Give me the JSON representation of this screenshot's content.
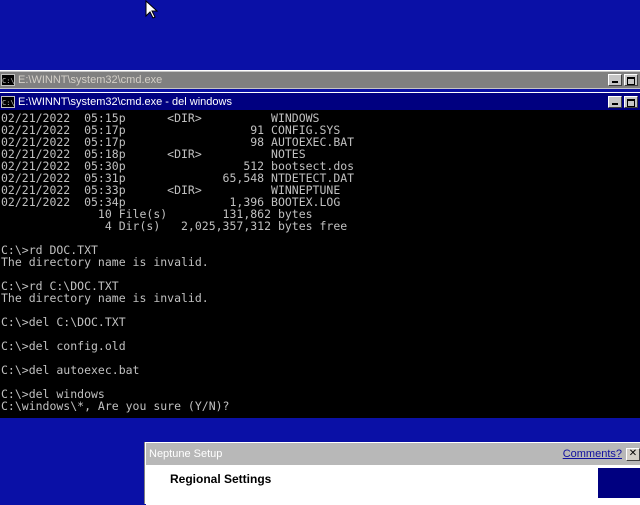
{
  "cursor": {
    "icon": "arrow-cursor-icon"
  },
  "back_window": {
    "title": "E:\\WINNT\\system32\\cmd.exe"
  },
  "front_window": {
    "title": "E:\\WINNT\\system32\\cmd.exe - del windows",
    "console_lines": [
      "02/21/2022  05:15p      <DIR>          WINDOWS",
      "02/21/2022  05:17p                  91 CONFIG.SYS",
      "02/21/2022  05:17p                  98 AUTOEXEC.BAT",
      "02/21/2022  05:18p      <DIR>          NOTES",
      "02/21/2022  05:30p                 512 bootsect.dos",
      "02/21/2022  05:31p              65,548 NTDETECT.DAT",
      "02/21/2022  05:33p      <DIR>          WINNEPTUNE",
      "02/21/2022  05:34p               1,396 BOOTEX.LOG",
      "              10 File(s)        131,862 bytes",
      "               4 Dir(s)   2,025,357,312 bytes free",
      "",
      "C:\\>rd DOC.TXT",
      "The directory name is invalid.",
      "",
      "C:\\>rd C:\\DOC.TXT",
      "The directory name is invalid.",
      "",
      "C:\\>del C:\\DOC.TXT",
      "",
      "C:\\>del config.old",
      "",
      "C:\\>del autoexec.bat",
      "",
      "C:\\>del windows",
      "C:\\windows\\*, Are you sure (Y/N)?"
    ]
  },
  "dialog": {
    "title": "Neptune Setup",
    "comments_link": "Comments?",
    "section": "Regional Settings"
  },
  "colors": {
    "desktop": "#0a10a6",
    "active_titlebar": "#000080",
    "inactive_titlebar": "#808080",
    "console_text": "#c0c0c0"
  }
}
